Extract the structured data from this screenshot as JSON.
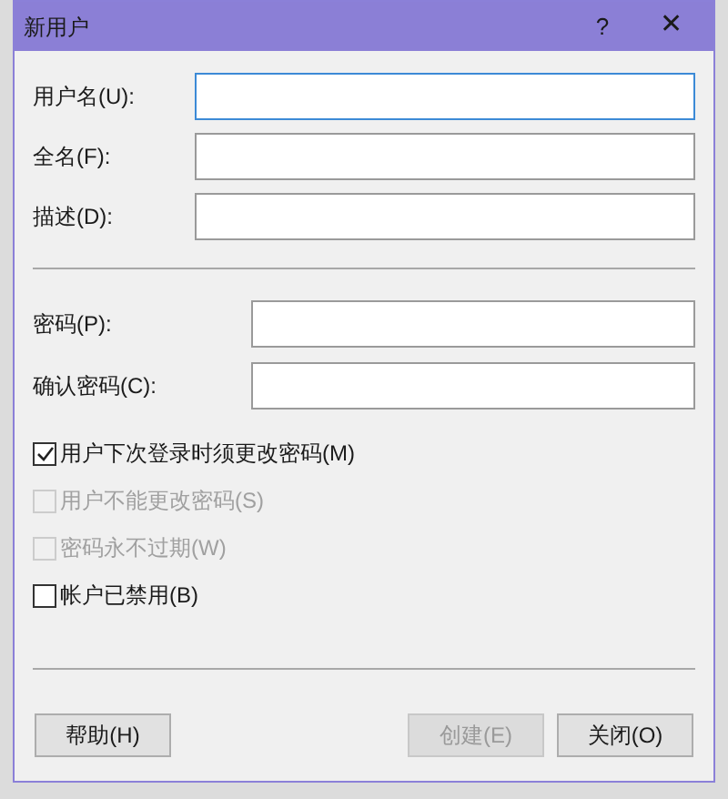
{
  "window": {
    "title": "新用户",
    "help": "?",
    "close": "✕"
  },
  "fields_top": [
    {
      "label": "用户名(U):",
      "focused": true
    },
    {
      "label": "全名(F):",
      "focused": false
    },
    {
      "label": "描述(D):",
      "focused": false
    }
  ],
  "fields_password": [
    {
      "label": "密码(P):",
      "focused": false
    },
    {
      "label": "确认密码(C):",
      "focused": false
    }
  ],
  "options": [
    {
      "label": "用户下次登录时须更改密码(M)",
      "checked": true,
      "disabled": false
    },
    {
      "label": "用户不能更改密码(S)",
      "checked": false,
      "disabled": true
    },
    {
      "label": "密码永不过期(W)",
      "checked": false,
      "disabled": true
    },
    {
      "label": "帐户已禁用(B)",
      "checked": false,
      "disabled": false
    }
  ],
  "buttons": [
    {
      "label": "帮助(H)",
      "disabled": false
    },
    {
      "label": "创建(E)",
      "disabled": true
    },
    {
      "label": "关闭(O)",
      "disabled": false
    }
  ]
}
